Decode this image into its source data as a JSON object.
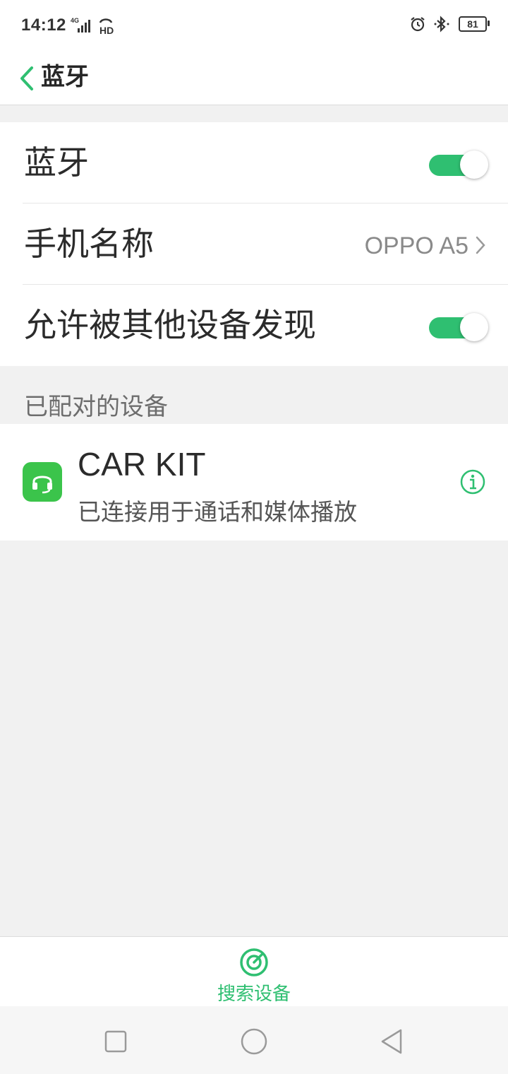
{
  "status_bar": {
    "time": "14:12",
    "network": "4G",
    "hd": "HD",
    "battery": "81"
  },
  "header": {
    "title": "蓝牙"
  },
  "settings": {
    "bluetooth_label": "蓝牙",
    "bluetooth_enabled": true,
    "phone_name_label": "手机名称",
    "phone_name_value": "OPPO A5",
    "discoverable_label": "允许被其他设备发现",
    "discoverable_enabled": true
  },
  "paired": {
    "section_label": "已配对的设备",
    "devices": [
      {
        "name": "CAR KIT",
        "status": "已连接用于通话和媒体播放"
      }
    ]
  },
  "actions": {
    "search_label": "搜索设备"
  },
  "colors": {
    "accent": "#2fbf71",
    "device_icon_bg": "#3bc44b",
    "background": "#f1f1f1"
  }
}
